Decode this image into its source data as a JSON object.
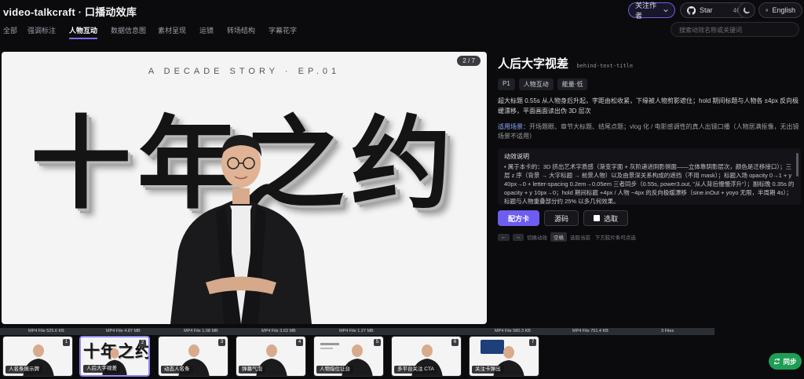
{
  "app": {
    "title": "video-talkcraft · 口播动效库"
  },
  "header": {
    "follow_label": "关注作者",
    "star_label": "Star",
    "star_count": "468",
    "lang_label": "English"
  },
  "nav": {
    "tabs": [
      {
        "label": "全部"
      },
      {
        "label": "强调标注"
      },
      {
        "label": "人物互动"
      },
      {
        "label": "数据信息图"
      },
      {
        "label": "素材呈现"
      },
      {
        "label": "运镜"
      },
      {
        "label": "转场结构"
      },
      {
        "label": "字幕花字"
      }
    ],
    "active_index": 2,
    "search_placeholder": "搜索动效名称或关键词"
  },
  "preview": {
    "subtitle": "A DECADE STORY · EP.01",
    "big_text": "十年之约",
    "counter": "2 / 7"
  },
  "info": {
    "title": "人后大字视差",
    "slug": "behind-text-title",
    "tags": [
      "P1",
      "人物互动",
      "能量·低"
    ],
    "description": "超大标题 0.55s 从人物身后升起，字距由松收紧，下缘被人物剪影遮住；hold 期间标题与人物各 ±4px 反向极缓漂移，平面画面读出伪 3D 层次",
    "scenario_label": "适用场景：",
    "scenario_text": "开场题眼、章节大标题、结尾点题；vlog 化 / 电影感调性的真人出镜口播（人物居满抠像，无出镜场景不适用）",
    "dynamics_title": "动效说明",
    "dynamics_text": "• 属于本卡的：3D 挤出艺术字质感（渐变字面 + 灰阶递进阴影侧面——立体靠阴影层次，颜色是迁移接口）；三层 z 序（背景 → 大字标题 → 前景人物）以及由景深关系构成的遮挡（不用 mask）；标题入场 opacity 0→1 + y 40px→0 + letter-spacing 0.2em→0.05em 三者同步（0.55s, power3.out, \"从人背后慢慢浮升\"）；副标晚 0.35s 的 opacity + y 10px→0；hold 期间标题 +4px / 人物 −4px 的反向极缓漂移（sine.inOut + yoyo 无限，半周期 4s）；标题与人物重叠部分约 25% 以多几何效果。",
    "primary_button": "配方卡",
    "source_button": "源码",
    "select_label": "选取",
    "hint_text": "切换动效",
    "hint_key": "空格",
    "hint_tail": "选取当前 · 下方胶片条可点选"
  },
  "strip": {
    "files": [
      {
        "label": "MP4 File 525.6 KB"
      },
      {
        "label": "MP4 File 4.87 MB"
      },
      {
        "label": "MP4 File 1.08 MB"
      },
      {
        "label": "MP4 File 3.63 MB"
      },
      {
        "label": "MP4 File 1.27 MB"
      },
      {
        "label": "MP4 File 580.3 KB"
      },
      {
        "label": "MP4 File 751.4 KB"
      },
      {
        "label": "3 Files"
      }
    ],
    "thumbs": [
      {
        "num": "1",
        "label": "人名条展示牌"
      },
      {
        "num": "2",
        "label": "人后大字视差",
        "big": "十年之约"
      },
      {
        "num": "3",
        "label": "动态人名条"
      },
      {
        "num": "4",
        "label": "弹幕气泡"
      },
      {
        "num": "5",
        "label": "人物指位让台"
      },
      {
        "num": "6",
        "label": "多平台关注 CTA"
      },
      {
        "num": "7",
        "label": "关注卡弹出"
      }
    ],
    "sync_label": "同步"
  },
  "colors": {
    "accent": "#6d5df0",
    "sync": "#1f9d55",
    "bg": "#0b0b0d"
  }
}
